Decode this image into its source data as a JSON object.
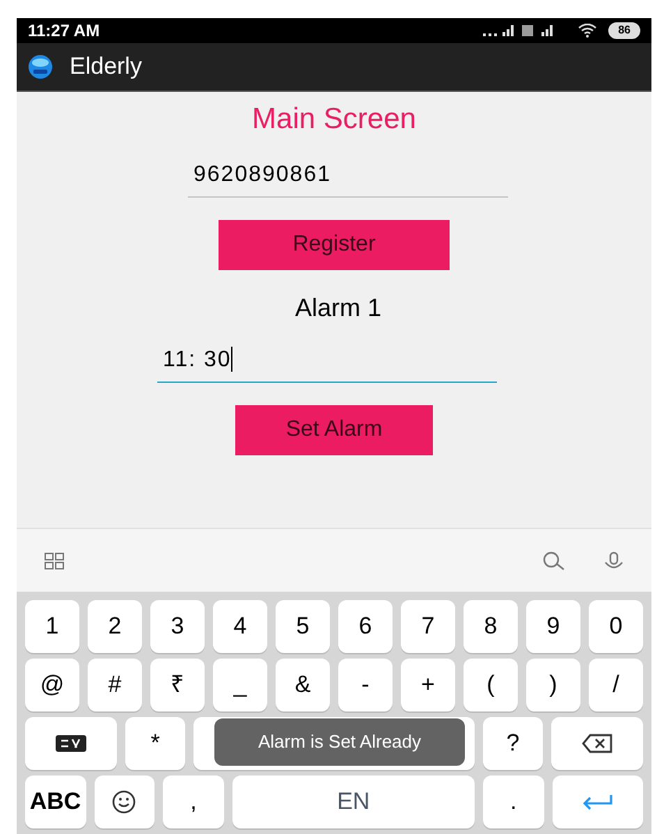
{
  "status_bar": {
    "time": "11:27 AM",
    "battery": "86"
  },
  "app_bar": {
    "title": "Elderly"
  },
  "main": {
    "heading": "Main Screen",
    "phone_field": {
      "value": "9620890861",
      "focused": false
    },
    "register_button": "Register",
    "alarm_label": "Alarm 1",
    "alarm_field": {
      "value": "11: 30",
      "focused": true
    },
    "set_alarm_button": "Set Alarm"
  },
  "keyboard": {
    "number_row": {
      "keys": [
        {
          "kind": "char",
          "label": "1"
        },
        {
          "kind": "char",
          "label": "2"
        },
        {
          "kind": "char",
          "label": "3"
        },
        {
          "kind": "char",
          "label": "4"
        },
        {
          "kind": "char",
          "label": "5"
        },
        {
          "kind": "char",
          "label": "6"
        },
        {
          "kind": "char",
          "label": "7"
        },
        {
          "kind": "char",
          "label": "8"
        },
        {
          "kind": "char",
          "label": "9"
        },
        {
          "kind": "char",
          "label": "0"
        }
      ]
    },
    "symbol_row": {
      "keys": [
        {
          "kind": "char",
          "label": "@"
        },
        {
          "kind": "char",
          "label": "#"
        },
        {
          "kind": "char",
          "label": "₹"
        },
        {
          "kind": "char",
          "label": "_"
        },
        {
          "kind": "char",
          "label": "&"
        },
        {
          "kind": "char",
          "label": "-"
        },
        {
          "kind": "char",
          "label": "+"
        },
        {
          "kind": "char",
          "label": "("
        },
        {
          "kind": "char",
          "label": ")"
        },
        {
          "kind": "char",
          "label": "/"
        }
      ]
    },
    "third_row": {
      "keys": [
        {
          "kind": "mode"
        },
        {
          "kind": "char",
          "label": "*"
        },
        {
          "kind": "hidden"
        },
        {
          "kind": "char",
          "label": "?"
        },
        {
          "kind": "backspace"
        }
      ]
    },
    "bottom_row": {
      "keys": [
        {
          "kind": "layout",
          "label": "ABC"
        },
        {
          "kind": "emoji"
        },
        {
          "kind": "char",
          "label": ","
        },
        {
          "kind": "space",
          "label": "EN"
        },
        {
          "kind": "char",
          "label": "."
        },
        {
          "kind": "enter"
        }
      ]
    }
  },
  "toast": "Alarm is Set Already"
}
